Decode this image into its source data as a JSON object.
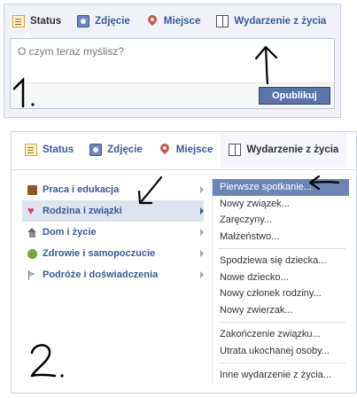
{
  "panel1": {
    "tabs": [
      {
        "label": "Status",
        "icon": "status-icon"
      },
      {
        "label": "Zdjęcie",
        "icon": "photo-icon"
      },
      {
        "label": "Miejsce",
        "icon": "place-icon"
      },
      {
        "label": "Wydarzenie z życia",
        "icon": "book-icon"
      }
    ],
    "composer": {
      "placeholder": "O czym teraz myślisz?"
    },
    "publish_label": "Opublikuj",
    "annotation": "1."
  },
  "panel2": {
    "tabs": [
      {
        "label": "Status",
        "icon": "status-icon"
      },
      {
        "label": "Zdjęcie",
        "icon": "photo-icon"
      },
      {
        "label": "Miejsce",
        "icon": "place-icon"
      },
      {
        "label": "Wydarzenie z życia",
        "icon": "book-icon"
      }
    ],
    "categories": [
      {
        "label": "Praca i edukacja",
        "icon": "briefcase-icon"
      },
      {
        "label": "Rodzina i związki",
        "icon": "heart-icon",
        "selected": true
      },
      {
        "label": "Dom i życie",
        "icon": "house-icon"
      },
      {
        "label": "Zdrowie i samopoczucie",
        "icon": "apple-icon"
      },
      {
        "label": "Podróże i doświadczenia",
        "icon": "flag-icon"
      }
    ],
    "subgroups": [
      [
        "Pierwsze spotkanie...",
        "Nowy związek...",
        "Zaręczyny...",
        "Małżeństwo..."
      ],
      [
        "Spodziewa się dziecka...",
        "Nowe dziecko...",
        "Nowy członek rodziny...",
        "Nowy zwierzak..."
      ],
      [
        "Zakończenie związku...",
        "Utrata ukochanej osoby..."
      ],
      [
        "Inne wydarzenie z życia..."
      ]
    ],
    "annotation": "2."
  },
  "colors": {
    "link": "#3b5998",
    "accent": "#5b74a8",
    "highlight": "#6d84b4"
  }
}
